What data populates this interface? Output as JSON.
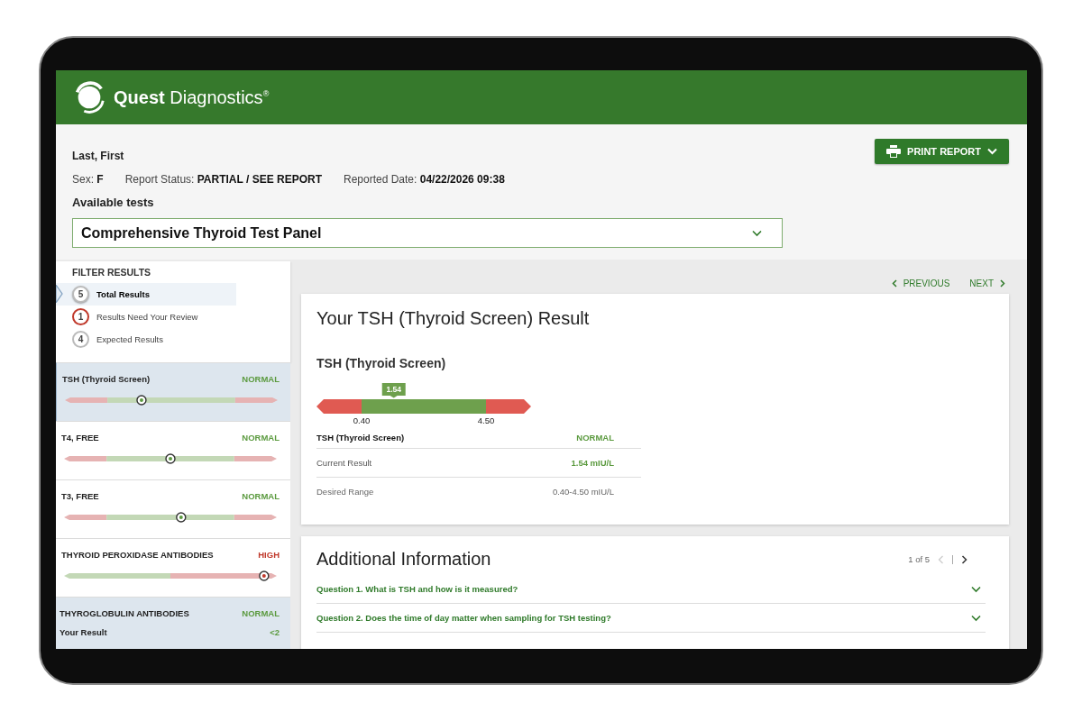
{
  "header": {
    "logo": "**Quest** Diagnostics$^{®}$"
  },
  "patient": {
    "name": "Last, First",
    "fields": [
      "Sex: **F**",
      "Report Status: **PARTIAL / SEE REPORT**",
      "Reported Date: **04/22/2026 09:38**"
    ],
    "print_button": "PRINT REPORT"
  },
  "tests": {
    "label": "Available tests",
    "value": "Comprehensive Thyroid Test Panel"
  },
  "filter": {
    "title": "FILTER RESULTS",
    "items": [
      {
        "count": "5",
        "label": "Total Results",
        "selected": true,
        "color": "#bbbbbb"
      },
      {
        "count": "1",
        "label": "Results Need Your Review",
        "selected": false,
        "color": "#c0392b"
      },
      {
        "count": "4",
        "label": "Expected Results",
        "selected": false,
        "color": "#bbbbbb"
      }
    ]
  },
  "results": [
    {
      "kind": "range",
      "name": "TSH (Thyroid Screen)",
      "status": "NORMAL",
      "color": "#5b9a3f",
      "level": 0.36,
      "selected": true
    },
    {
      "kind": "range",
      "name": "T4, FREE",
      "status": "NORMAL",
      "color": "#5b9a3f",
      "level": 0.5,
      "selected": false
    },
    {
      "kind": "range",
      "name": "T3, FREE",
      "status": "NORMAL",
      "color": "#5b9a3f",
      "level": 0.55,
      "selected": false
    },
    {
      "kind": "upper_limit",
      "name": "THYROID PEROXIDASE ANTIBODIES",
      "status": "HIGH",
      "color": "#c0392b",
      "level": 0.94,
      "selected": false
    },
    {
      "kind": "value",
      "name": "THYROGLOBULIN ANTIBODIES",
      "status": "NORMAL",
      "color": "#5b9a3f",
      "value_label": "Your Result",
      "value": "<2",
      "selected": false
    }
  ],
  "nav": {
    "previous": "PREVIOUS",
    "next": "NEXT"
  },
  "result_card": {
    "title": "Your TSH (Thyroid Screen) Result",
    "test": "TSH (Thyroid Screen)",
    "marker": "1.54",
    "level": 0.36,
    "low": "0.40",
    "high": "4.50",
    "rows": [
      {
        "kind": "header",
        "label": "TSH (Thyroid Screen)",
        "value": "NORMAL"
      },
      {
        "kind": "result",
        "label": "Current Result",
        "value": "1.54 mIU/L"
      },
      {
        "kind": "range",
        "label": "Desired Range",
        "value": "0.40-4.50 mIU/L"
      }
    ]
  },
  "info_card": {
    "title": "Additional Information",
    "page": "1 of 5",
    "prev_disabled": true,
    "questions": [
      {
        "text": "Question 1. What is TSH and how is it measured?",
        "expanded": false
      },
      {
        "text": "Question 2. Does the time of day matter when sampling for TSH testing?",
        "expanded": false
      }
    ]
  }
}
